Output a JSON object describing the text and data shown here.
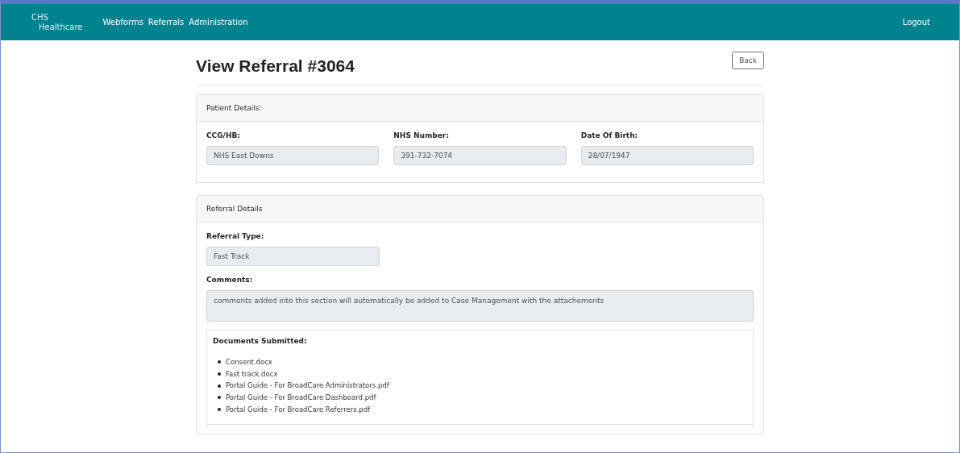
{
  "navbar": {
    "logo": [
      "CHS",
      "Healthcare"
    ],
    "links": [
      "Webforms",
      "Referrals",
      "Administration"
    ],
    "logout": "Logout"
  },
  "page": {
    "title": "View Referral #3064",
    "back_button": "Back"
  },
  "patient_details": {
    "header": "Patient Details:",
    "fields": [
      {
        "label": "CCG/HB:",
        "value": "NHS East Downs"
      },
      {
        "label": "NHS Number:",
        "value": "391-732-7074"
      },
      {
        "label": "Date Of Birth:",
        "value": "28/07/1947"
      }
    ]
  },
  "referral_details": {
    "header": "Referral Details",
    "referral_type": {
      "label": "Referral Type:",
      "value": "Fast Track"
    },
    "comments": {
      "label": "Comments:",
      "value": "comments added into this section will automatically be added to Case Management with the attachements"
    },
    "documents": {
      "title": "Documents Submitted:",
      "items": [
        "Consent.docx",
        "Fast track.docx",
        "Portal Guide - For BroadCare Administrators.pdf",
        "Portal Guide - For BroadCare Dashboard.pdf",
        "Portal Guide - For BroadCare Referrers.pdf"
      ]
    }
  }
}
